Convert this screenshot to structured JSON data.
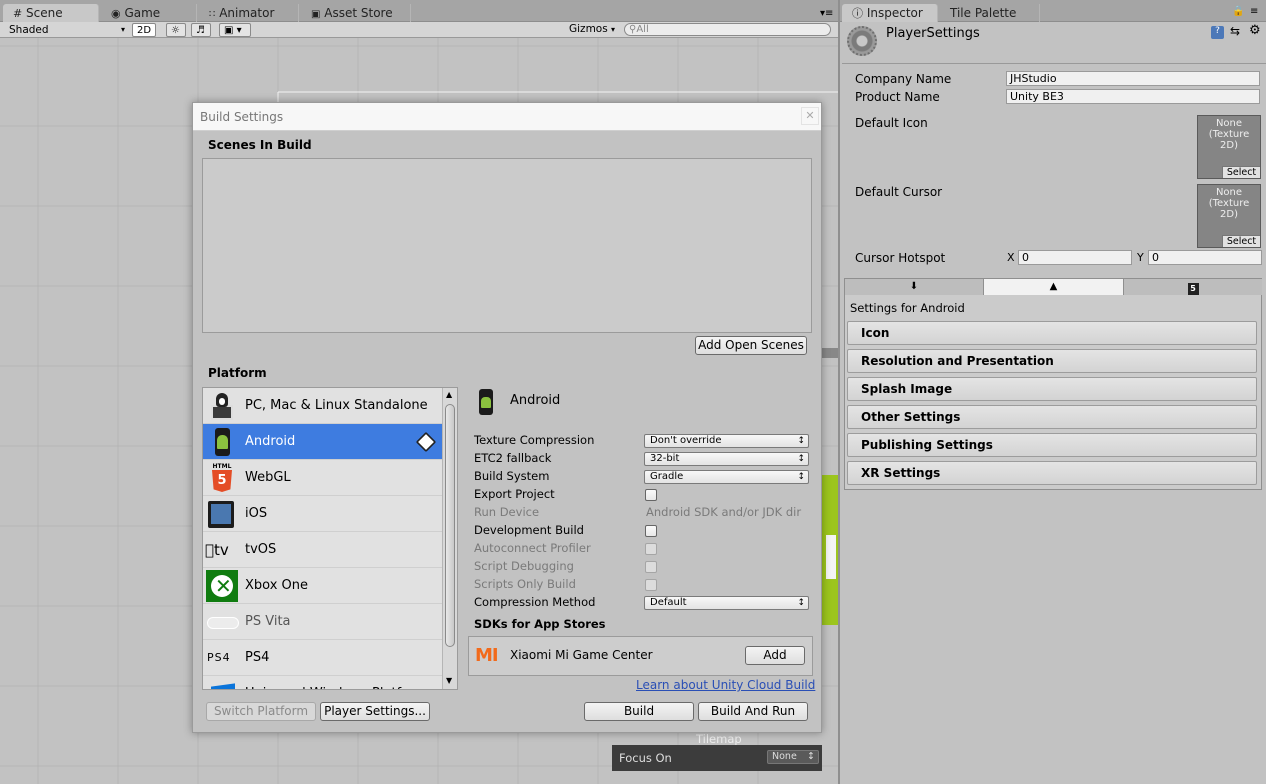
{
  "scene_tabs": [
    {
      "label": "Scene"
    },
    {
      "label": "Game"
    },
    {
      "label": "Animator"
    },
    {
      "label": "Asset Store"
    }
  ],
  "scene_toolbar": {
    "shading": "Shaded",
    "mode_2d": "2D",
    "gizmos": "Gizmos",
    "search_placeholder": "All"
  },
  "inspector_tabs": [
    {
      "label": "Inspector"
    },
    {
      "label": "Tile Palette"
    }
  ],
  "build": {
    "title": "Build Settings",
    "scenes_header": "Scenes In Build",
    "add_open_scenes": "Add Open Scenes",
    "platform_header": "Platform",
    "platforms": [
      {
        "label": "PC, Mac & Linux Standalone",
        "icon": "pc-standalone-icon"
      },
      {
        "label": "Android",
        "icon": "android-icon"
      },
      {
        "label": "WebGL",
        "icon": "html5-icon"
      },
      {
        "label": "iOS",
        "icon": "ipad-icon"
      },
      {
        "label": "tvOS",
        "icon": "apple-tv-icon"
      },
      {
        "label": "Xbox One",
        "icon": "xbox-icon"
      },
      {
        "label": "PS Vita",
        "icon": "ps-vita-icon"
      },
      {
        "label": "PS4",
        "icon": "ps4-logo-icon"
      },
      {
        "label": "Universal Windows Platf",
        "icon": "windows-icon"
      }
    ],
    "selected_platform": "Android",
    "settings_title": "Android",
    "texture_compression": {
      "label": "Texture Compression",
      "value": "Don't override"
    },
    "etc2_fallback": {
      "label": "ETC2 fallback",
      "value": "32-bit"
    },
    "build_system": {
      "label": "Build System",
      "value": "Gradle"
    },
    "export_project": {
      "label": "Export Project"
    },
    "run_device": {
      "label": "Run Device",
      "value": "Android SDK and/or JDK dir"
    },
    "development_build": {
      "label": "Development Build"
    },
    "autoconnect_profiler": {
      "label": "Autoconnect Profiler"
    },
    "script_debugging": {
      "label": "Script Debugging"
    },
    "scripts_only_build": {
      "label": "Scripts Only Build"
    },
    "compression_method": {
      "label": "Compression Method",
      "value": "Default"
    },
    "sdks_header": "SDKs for App Stores",
    "sdk_name": "Xiaomi Mi Game Center",
    "sdk_add": "Add",
    "cloud_link": "Learn about Unity Cloud Build",
    "switch_platform": "Switch Platform",
    "player_settings": "Player Settings...",
    "build_button": "Build",
    "build_and_run": "Build And Run"
  },
  "inspector": {
    "title": "PlayerSettings",
    "company_name": {
      "label": "Company Name",
      "value": "JHStudio"
    },
    "product_name": {
      "label": "Product Name",
      "value": "Unity BE3"
    },
    "default_icon": {
      "label": "Default Icon",
      "none": "None\n(Texture\n2D)",
      "select": "Select"
    },
    "default_cursor": {
      "label": "Default Cursor",
      "none": "None\n(Texture\n2D)",
      "select": "Select"
    },
    "cursor_hotspot": {
      "label": "Cursor Hotspot",
      "x_label": "X",
      "x": "0",
      "y_label": "Y",
      "y": "0"
    },
    "settings_for": "Settings for Android",
    "sections": [
      "Icon",
      "Resolution and Presentation",
      "Splash Image",
      "Other Settings",
      "Publishing Settings",
      "XR Settings"
    ]
  },
  "tilemap": {
    "label": "Tilemap",
    "focus_on": "Focus On",
    "focus_value": "None"
  },
  "colors": {
    "selection": "#3e7ce0",
    "link": "#2a4fb5",
    "mi_orange": "#f26a1b",
    "xbox_green": "#107c10",
    "html5_orange": "#e44d26"
  }
}
